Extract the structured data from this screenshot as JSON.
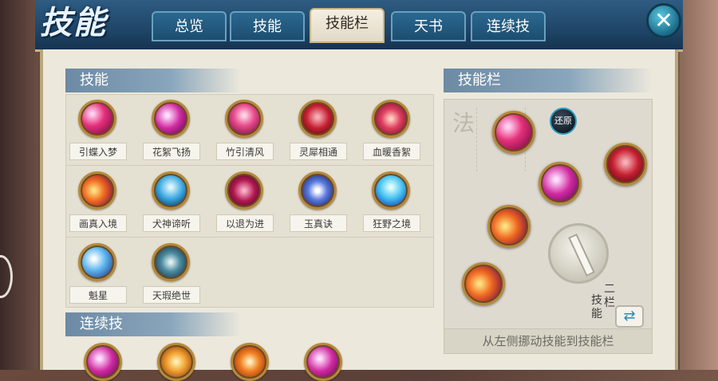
{
  "window": {
    "title": "技能",
    "tabs": [
      {
        "label": "总览",
        "active": false
      },
      {
        "label": "技能",
        "active": false
      },
      {
        "label": "技能栏",
        "active": true
      },
      {
        "label": "天书",
        "active": false
      },
      {
        "label": "连续技",
        "active": false
      }
    ],
    "close_icon": "close-icon"
  },
  "skills_section": {
    "title": "技能",
    "items": [
      {
        "label": "引蝶入梦",
        "icon": "butterfly-dream-icon"
      },
      {
        "label": "花絮飞扬",
        "icon": "flying-petals-icon"
      },
      {
        "label": "竹引清风",
        "icon": "bamboo-breeze-icon"
      },
      {
        "label": "灵犀相通",
        "icon": "spirit-link-icon"
      },
      {
        "label": "血暖香絮",
        "icon": "blood-warmth-icon"
      },
      {
        "label": "画真入境",
        "icon": "painting-realm-icon"
      },
      {
        "label": "犬神谛听",
        "icon": "dog-spirit-icon"
      },
      {
        "label": "以退为进",
        "icon": "retreat-advance-icon"
      },
      {
        "label": "玉真诀",
        "icon": "jade-secret-icon"
      },
      {
        "label": "狂野之境",
        "icon": "wild-realm-icon"
      },
      {
        "label": "魁星",
        "icon": "star-icon"
      },
      {
        "label": "天瑕绝世",
        "icon": "heavenly-jade-icon"
      }
    ]
  },
  "combo_section": {
    "title": "连续技"
  },
  "skillbar_section": {
    "title": "技能栏",
    "restore_label": "还原",
    "switch_text_1": "二栏",
    "switch_text_2": "技能",
    "hint": "从左侧挪动技能到技能栏"
  },
  "colors": {
    "frame_blue": "#1f4668",
    "panel_bg": "#ece8dc",
    "header_blue": "#6c8aa4",
    "icon_ring_gold": "#b5893c"
  }
}
